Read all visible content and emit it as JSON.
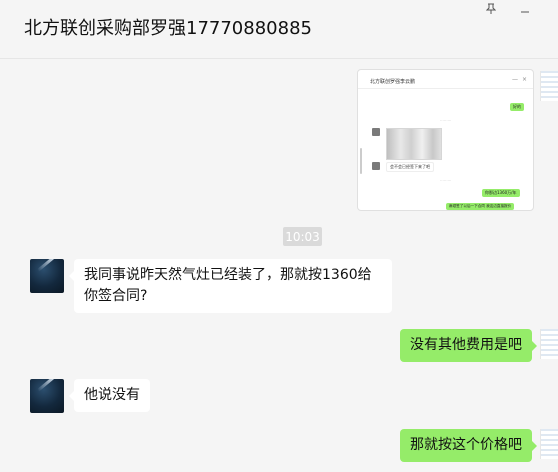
{
  "window": {
    "title": "北方联创采购部罗强17770880885",
    "pin_icon": "pin-icon",
    "minimize_icon": "minimize-icon"
  },
  "screenshot": {
    "title": "北方联创罗强李云鹏",
    "msg_1": "好的",
    "msg_2": "会不会已经签下来了吧",
    "msg_3": "你那边1360万/年",
    "msg_4": "麻烦签了以后一下合同 我这边直接报价"
  },
  "messages": [
    {
      "side": "time",
      "text": "10:03"
    },
    {
      "side": "in",
      "text": "我同事说昨天然气灶已经装了，那就按1360给你签合同?"
    },
    {
      "side": "out",
      "text": "没有其他费用是吧"
    },
    {
      "side": "in",
      "text": "他说没有"
    },
    {
      "side": "out",
      "text": "那就按这个价格吧"
    }
  ]
}
